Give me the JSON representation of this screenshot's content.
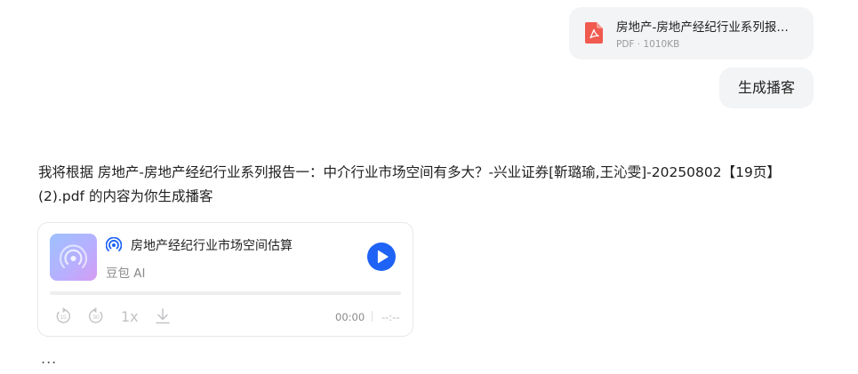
{
  "attachment": {
    "file_name": "房地产-房地产经纪行业系列报告一：中介行业市场空间有多大？-兴业证券[靳璐瑜,王沁雯]-20250802【19页】(2).pdf",
    "meta": "PDF · 1010KB",
    "icon": "pdf-icon",
    "icon_color": "#f05a4f"
  },
  "user_prompt": "生成播客",
  "reply": {
    "text": "我将根据 房地产-房地产经纪行业系列报告一：中介行业市场空间有多大？-兴业证券[靳璐瑜,王沁雯]-20250802【19页】(2).pdf 的内容为你生成播客"
  },
  "podcast": {
    "title": "房地产经纪行业市场空间估算",
    "author": "豆包 AI",
    "accent_color": "#1e63f5",
    "progress_fraction": 0,
    "controls": {
      "rewind_label": "15",
      "forward_label": "30",
      "speed": "1x",
      "download_icon": "download-icon"
    },
    "time_current": "00:00",
    "time_total": "--:--"
  },
  "more": "..."
}
